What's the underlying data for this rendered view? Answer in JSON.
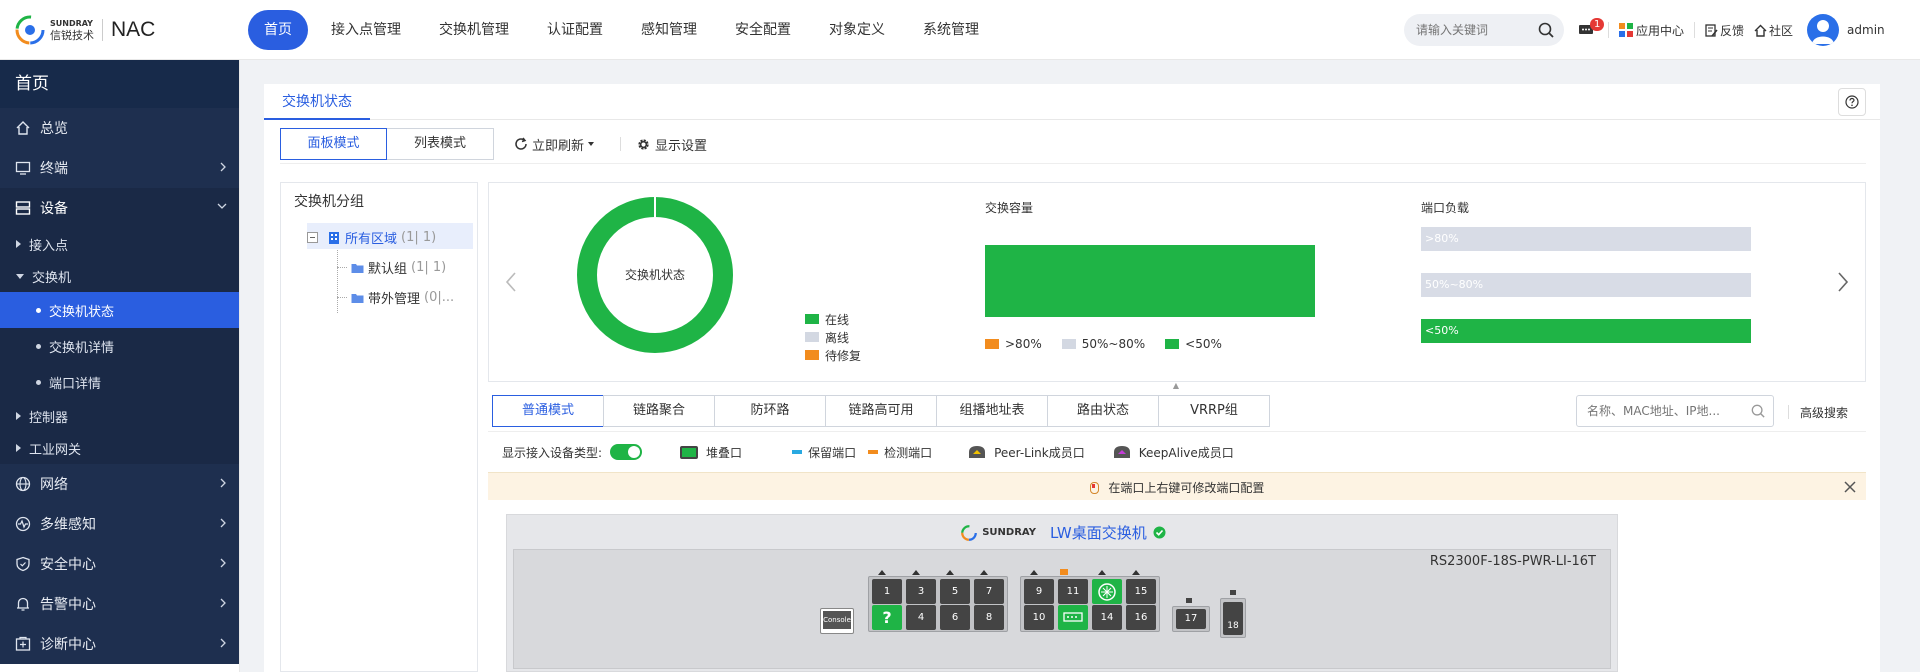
{
  "brand": {
    "sub_top": "SUNDRAY",
    "sub_bottom": "信锐技术",
    "product": "NAC"
  },
  "nav": [
    "首页",
    "接入点管理",
    "交换机管理",
    "认证配置",
    "感知管理",
    "安全配置",
    "对象定义",
    "系统管理"
  ],
  "search": {
    "placeholder": "请输入关键词"
  },
  "topright": {
    "msg_count": "1",
    "app_center": "应用中心",
    "feedback": "反馈",
    "community": "社区",
    "user": "admin"
  },
  "sidebar": {
    "title": "首页",
    "items": {
      "overview": "总览",
      "terminal": "终端",
      "device": "设备",
      "ap": "接入点",
      "switch": "交换机",
      "switch_status": "交换机状态",
      "switch_detail": "交换机详情",
      "port_detail": "端口详情",
      "controller": "控制器",
      "industrial_gw": "工业网关",
      "network": "网络",
      "multi_sense": "多维感知",
      "security_center": "安全中心",
      "alarm_center": "告警中心",
      "diag_center": "诊断中心"
    }
  },
  "page": {
    "tab": "交换机状态",
    "mode_panel": "面板模式",
    "mode_list": "列表模式",
    "refresh": "立即刷新",
    "display_settings": "显示设置"
  },
  "tree": {
    "title": "交换机分组",
    "all": "所有区域",
    "all_cnt": "(1| 1)",
    "default": "默认组",
    "default_cnt": "(1| 1)",
    "oob": "带外管理",
    "oob_cnt": "(0|..."
  },
  "status_chart": {
    "center_label": "交换机状态",
    "legend": {
      "online": "在线",
      "offline": "离线",
      "pending": "待修复"
    },
    "colors": {
      "online": "#1fb446",
      "offline": "#d3d8e2",
      "pending": "#f28c1e"
    }
  },
  "capacity": {
    "title": "交换容量",
    "legend": {
      "high": ">80%",
      "mid": "50%~80%",
      "low": "<50%"
    }
  },
  "port_load": {
    "title": "端口负载",
    "bars": {
      "high": ">80%",
      "mid": "50%~80%",
      "low": "<50%"
    }
  },
  "port_tabs": [
    "普通模式",
    "链路聚合",
    "防环路",
    "链路高可用",
    "组播地址表",
    "路由状态",
    "VRRP组"
  ],
  "port_search": {
    "placeholder": "名称、MAC地址、IP地...",
    "advanced": "高级搜索"
  },
  "legend_row": {
    "show_access": "显示接入设备类型:",
    "stack": "堆叠口",
    "reserved": "保留端口",
    "detect": "检测端口",
    "peer": "Peer-Link成员口",
    "keepalive": "KeepAlive成员口"
  },
  "notice": {
    "text": "在端口上右键可修改端口配置"
  },
  "switch": {
    "brand": "SUNDRAY",
    "name": "LW桌面交换机",
    "model": "RS2300F-18S-PWR-LI-16T",
    "console": "Console",
    "ports_top_a": [
      "1",
      "3",
      "5",
      "7"
    ],
    "ports_bot_a": [
      "?",
      "4",
      "6",
      "8"
    ],
    "ports_top_b": [
      "9",
      "11",
      "",
      "15"
    ],
    "ports_bot_b": [
      "10",
      "",
      "14",
      "16"
    ],
    "sfp": [
      "17",
      "18"
    ]
  }
}
